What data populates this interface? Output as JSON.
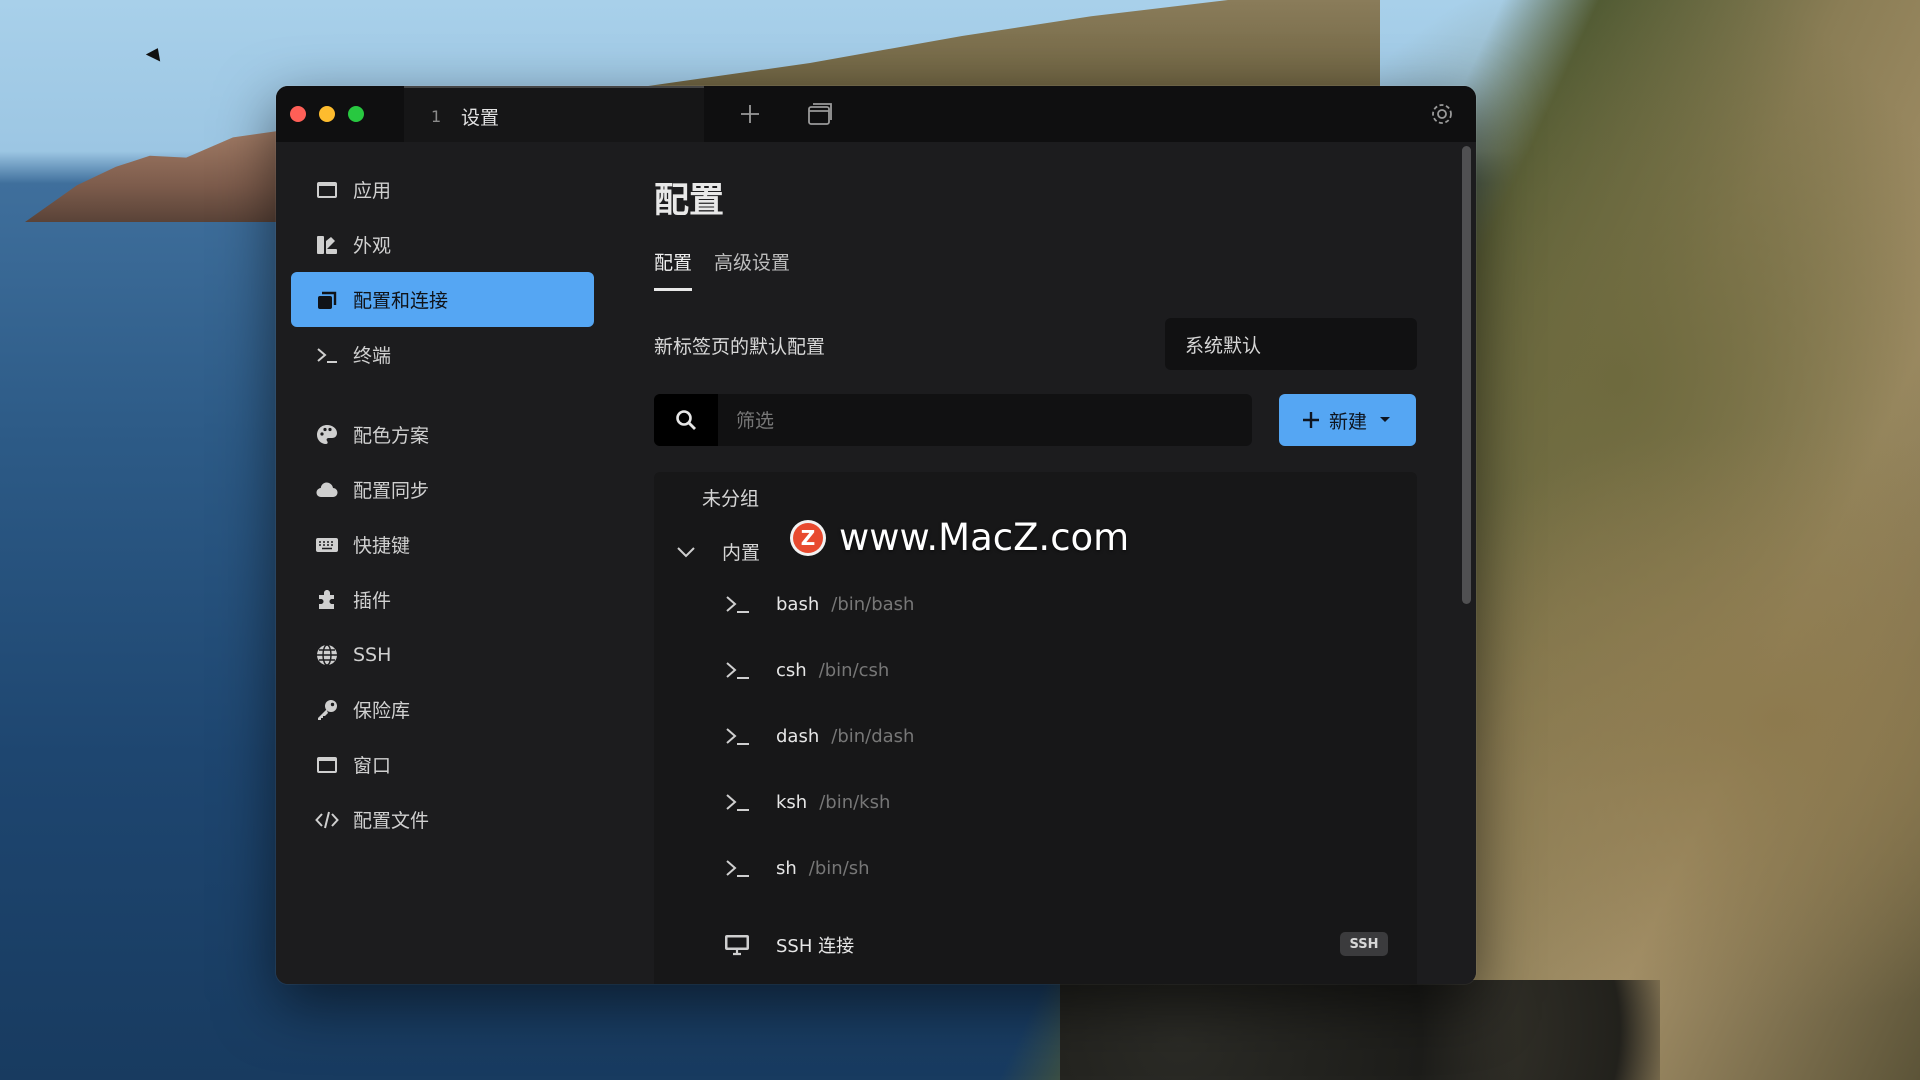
{
  "window": {
    "tab": {
      "number": "1",
      "title": "设置"
    }
  },
  "sidebar": {
    "items": [
      {
        "label": "应用",
        "icon": "window-icon"
      },
      {
        "label": "外观",
        "icon": "paint-icon"
      },
      {
        "label": "配置和连接",
        "icon": "profiles-icon",
        "active": true
      },
      {
        "label": "终端",
        "icon": "terminal-icon"
      },
      {
        "label": "配色方案",
        "icon": "palette-icon"
      },
      {
        "label": "配置同步",
        "icon": "cloud-icon"
      },
      {
        "label": "快捷键",
        "icon": "keyboard-icon"
      },
      {
        "label": "插件",
        "icon": "puzzle-icon"
      },
      {
        "label": "SSH",
        "icon": "globe-icon"
      },
      {
        "label": "保险库",
        "icon": "key-icon"
      },
      {
        "label": "窗口",
        "icon": "window-icon"
      },
      {
        "label": "配置文件",
        "icon": "code-icon"
      }
    ]
  },
  "main": {
    "title": "配置",
    "tabs": [
      {
        "label": "配置",
        "active": true
      },
      {
        "label": "高级设置"
      }
    ],
    "default_profile_label": "新标签页的默认配置",
    "default_profile_value": "系统默认",
    "filter_placeholder": "筛选",
    "new_button_label": "新建",
    "ungrouped_label": "未分组",
    "builtin_group_label": "内置",
    "profiles": [
      {
        "name": "bash",
        "path": "/bin/bash"
      },
      {
        "name": "csh",
        "path": "/bin/csh"
      },
      {
        "name": "dash",
        "path": "/bin/dash"
      },
      {
        "name": "ksh",
        "path": "/bin/ksh"
      },
      {
        "name": "sh",
        "path": "/bin/sh"
      }
    ],
    "ssh_item": {
      "name": "SSH 连接",
      "badge": "SSH"
    }
  },
  "watermark": {
    "logo_letter": "Z",
    "text": "www.MacZ.com"
  },
  "colors": {
    "accent": "#55a6f3",
    "window_bg": "#1c1c1e",
    "titlebar_bg": "#0f0f10"
  }
}
